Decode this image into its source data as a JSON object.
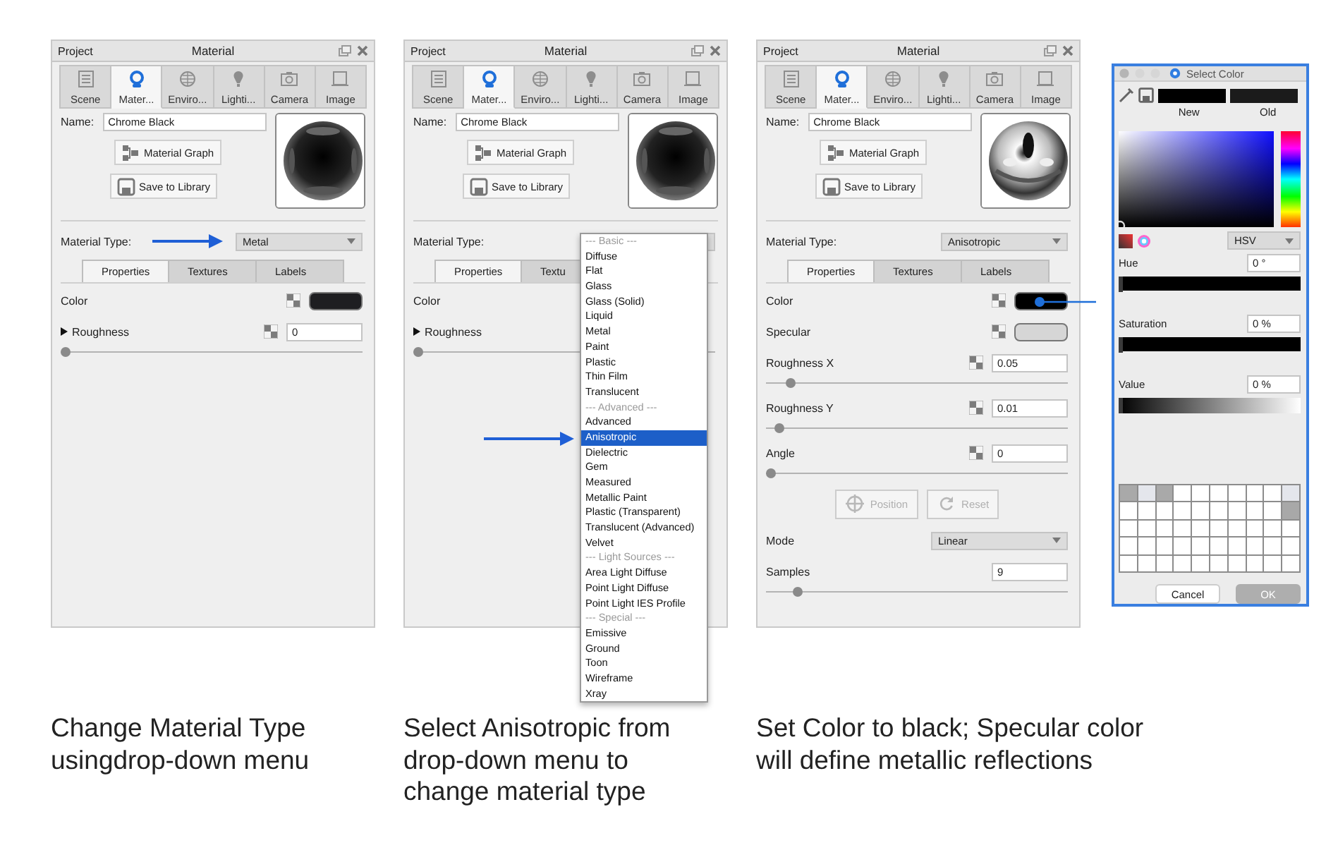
{
  "panels": [
    {
      "header": {
        "left": "Project",
        "title": "Material"
      },
      "tabs": [
        {
          "label": "Scene",
          "kind": "scene",
          "selected": false
        },
        {
          "label": "Mater...",
          "kind": "material",
          "selected": true
        },
        {
          "label": "Enviro...",
          "kind": "environment",
          "selected": false
        },
        {
          "label": "Lighti...",
          "kind": "lighting",
          "selected": false
        },
        {
          "label": "Camera",
          "kind": "camera",
          "selected": false
        },
        {
          "label": "Image",
          "kind": "image",
          "selected": false
        }
      ],
      "name": {
        "label": "Name:",
        "value": "Chrome Black"
      },
      "actions": [
        {
          "label": "Material Graph",
          "kind": "graph"
        },
        {
          "label": "Save to Library",
          "kind": "save"
        }
      ],
      "preview": {
        "kind": "dark"
      },
      "material_type": {
        "label": "Material Type:",
        "value": "Metal"
      },
      "sub_tabs": [
        {
          "label": "Properties",
          "selected": true
        },
        {
          "label": "Textures",
          "selected": false
        },
        {
          "label": "Labels",
          "selected": false
        }
      ],
      "properties": [
        {
          "kind": "color",
          "label": "Color",
          "texture": true,
          "color": "#1e1e21",
          "linked": false
        },
        {
          "kind": "number",
          "label": "Roughness",
          "expanded": false,
          "texture": true,
          "value": "0",
          "level": 0
        }
      ]
    },
    {
      "header": {
        "left": "Project",
        "title": "Material"
      },
      "tabs": [
        {
          "label": "Scene",
          "kind": "scene",
          "selected": false
        },
        {
          "label": "Mater...",
          "kind": "material",
          "selected": true
        },
        {
          "label": "Enviro...",
          "kind": "environment",
          "selected": false
        },
        {
          "label": "Lighti...",
          "kind": "lighting",
          "selected": false
        },
        {
          "label": "Camera",
          "kind": "camera",
          "selected": false
        },
        {
          "label": "Image",
          "kind": "image",
          "selected": false
        }
      ],
      "name": {
        "label": "Name:",
        "value": "Chrome Black"
      },
      "actions": [
        {
          "label": "Material Graph",
          "kind": "graph"
        },
        {
          "label": "Save to Library",
          "kind": "save"
        }
      ],
      "preview": {
        "kind": "dark"
      },
      "material_type": {
        "label": "Material Type:"
      },
      "sub_tabs": [
        {
          "label": "Properties",
          "selected": true
        },
        {
          "label": "Textu",
          "selected": false
        }
      ],
      "properties": [
        {
          "kind": "color",
          "label": "Color",
          "texture": false
        },
        {
          "kind": "number",
          "label": "Roughness",
          "expanded": false,
          "texture": false,
          "level": 0
        }
      ],
      "dropdown": [
        {
          "label": "--- Basic ---",
          "kind": "header",
          "selected": false
        },
        {
          "label": "Diffuse",
          "kind": "option",
          "selected": false
        },
        {
          "label": "Flat",
          "kind": "option",
          "selected": false
        },
        {
          "label": "Glass",
          "kind": "option",
          "selected": false
        },
        {
          "label": "Glass (Solid)",
          "kind": "option",
          "selected": false
        },
        {
          "label": "Liquid",
          "kind": "option",
          "selected": false
        },
        {
          "label": "Metal",
          "kind": "option",
          "selected": false
        },
        {
          "label": "Paint",
          "kind": "option",
          "selected": false
        },
        {
          "label": "Plastic",
          "kind": "option",
          "selected": false
        },
        {
          "label": "Thin Film",
          "kind": "option",
          "selected": false
        },
        {
          "label": "Translucent",
          "kind": "option",
          "selected": false
        },
        {
          "label": "--- Advanced ---",
          "kind": "header",
          "selected": false
        },
        {
          "label": "Advanced",
          "kind": "option",
          "selected": false
        },
        {
          "label": "Anisotropic",
          "kind": "option",
          "selected": true
        },
        {
          "label": "Dielectric",
          "kind": "option",
          "selected": false
        },
        {
          "label": "Gem",
          "kind": "option",
          "selected": false
        },
        {
          "label": "Measured",
          "kind": "option",
          "selected": false
        },
        {
          "label": "Metallic Paint",
          "kind": "option",
          "selected": false
        },
        {
          "label": "Plastic (Transparent)",
          "kind": "option",
          "selected": false
        },
        {
          "label": "Translucent (Advanced)",
          "kind": "option",
          "selected": false
        },
        {
          "label": "Velvet",
          "kind": "option",
          "selected": false
        },
        {
          "label": "--- Light Sources ---",
          "kind": "header",
          "selected": false
        },
        {
          "label": "Area Light Diffuse",
          "kind": "option",
          "selected": false
        },
        {
          "label": "Point Light Diffuse",
          "kind": "option",
          "selected": false
        },
        {
          "label": "Point Light IES Profile",
          "kind": "option",
          "selected": false
        },
        {
          "label": "--- Special ---",
          "kind": "header",
          "selected": false
        },
        {
          "label": "Emissive",
          "kind": "option",
          "selected": false
        },
        {
          "label": "Ground",
          "kind": "option",
          "selected": false
        },
        {
          "label": "Toon",
          "kind": "option",
          "selected": false
        },
        {
          "label": "Wireframe",
          "kind": "option",
          "selected": false
        },
        {
          "label": "Xray",
          "kind": "option",
          "selected": false
        }
      ]
    },
    {
      "header": {
        "left": "Project",
        "title": "Material"
      },
      "tabs": [
        {
          "label": "Scene",
          "kind": "scene",
          "selected": false
        },
        {
          "label": "Mater...",
          "kind": "material",
          "selected": true
        },
        {
          "label": "Enviro...",
          "kind": "environment",
          "selected": false
        },
        {
          "label": "Lighti...",
          "kind": "lighting",
          "selected": false
        },
        {
          "label": "Camera",
          "kind": "camera",
          "selected": false
        },
        {
          "label": "Image",
          "kind": "image",
          "selected": false
        }
      ],
      "name": {
        "label": "Name:",
        "value": "Chrome Black"
      },
      "actions": [
        {
          "label": "Material Graph",
          "kind": "graph"
        },
        {
          "label": "Save to Library",
          "kind": "save"
        }
      ],
      "preview": {
        "kind": "chrome"
      },
      "material_type": {
        "label": "Material Type:",
        "value": "Anisotropic"
      },
      "sub_tabs": [
        {
          "label": "Properties",
          "selected": true
        },
        {
          "label": "Textures",
          "selected": false
        },
        {
          "label": "Labels",
          "selected": false
        }
      ],
      "properties": [
        {
          "kind": "color",
          "label": "Color",
          "texture": true,
          "color": "#000000",
          "linked": true
        },
        {
          "kind": "color",
          "label": "Specular",
          "texture": true,
          "color": "#d6d6d6",
          "linked": false
        },
        {
          "kind": "number",
          "label": "Roughness X",
          "texture": true,
          "value": "0.05",
          "level": 0.07
        },
        {
          "kind": "number",
          "label": "Roughness Y",
          "texture": true,
          "value": "0.01",
          "level": 0.03
        },
        {
          "kind": "number",
          "label": "Angle",
          "texture": true,
          "value": "0",
          "level": 0
        },
        {
          "kind": "buttons",
          "buttons": [
            {
              "label": "Position",
              "kind": "target",
              "disabled": true
            },
            {
              "label": "Reset",
              "kind": "reset",
              "disabled": true
            }
          ]
        },
        {
          "kind": "select",
          "label": "Mode",
          "value": "Linear"
        },
        {
          "kind": "number",
          "label": "Samples",
          "texture": false,
          "value": "9",
          "level": 0.09
        }
      ]
    }
  ],
  "color_picker": {
    "title": "Select Color",
    "swatches": [
      {
        "label": "New",
        "color": "#000000"
      },
      {
        "label": "Old",
        "color": "#1b1b1b"
      }
    ],
    "model": "HSV",
    "channels": [
      {
        "label": "Hue",
        "value": "0 °",
        "kind": "hue",
        "level": 0
      },
      {
        "label": "Saturation",
        "value": "0 %",
        "kind": "saturation",
        "level": 0
      },
      {
        "label": "Value",
        "value": "0 %",
        "kind": "value",
        "level": 0
      }
    ],
    "custom_colors": [
      {
        "color": "#a9a9a9"
      },
      {
        "color": "#e4e6ec"
      },
      {
        "color": "#a9a9a9"
      },
      {
        "color": "#ffffff"
      },
      {
        "color": "#ffffff"
      },
      {
        "color": "#ffffff"
      },
      {
        "color": "#ffffff"
      },
      {
        "color": "#ffffff"
      },
      {
        "color": "#ffffff"
      },
      {
        "color": "#e4e6ec"
      },
      {
        "color": "#ffffff"
      },
      {
        "color": "#ffffff"
      },
      {
        "color": "#ffffff"
      },
      {
        "color": "#ffffff"
      },
      {
        "color": "#ffffff"
      },
      {
        "color": "#ffffff"
      },
      {
        "color": "#ffffff"
      },
      {
        "color": "#ffffff"
      },
      {
        "color": "#ffffff"
      },
      {
        "color": "#a8a8a8"
      },
      {
        "color": "#ffffff"
      },
      {
        "color": "#ffffff"
      },
      {
        "color": "#ffffff"
      },
      {
        "color": "#ffffff"
      },
      {
        "color": "#ffffff"
      },
      {
        "color": "#ffffff"
      },
      {
        "color": "#ffffff"
      },
      {
        "color": "#ffffff"
      },
      {
        "color": "#ffffff"
      },
      {
        "color": "#ffffff"
      },
      {
        "color": "#ffffff"
      },
      {
        "color": "#ffffff"
      },
      {
        "color": "#ffffff"
      },
      {
        "color": "#ffffff"
      },
      {
        "color": "#ffffff"
      },
      {
        "color": "#ffffff"
      },
      {
        "color": "#ffffff"
      },
      {
        "color": "#ffffff"
      },
      {
        "color": "#ffffff"
      },
      {
        "color": "#ffffff"
      },
      {
        "color": "#ffffff"
      },
      {
        "color": "#ffffff"
      },
      {
        "color": "#ffffff"
      },
      {
        "color": "#ffffff"
      },
      {
        "color": "#ffffff"
      },
      {
        "color": "#ffffff"
      },
      {
        "color": "#ffffff"
      },
      {
        "color": "#ffffff"
      },
      {
        "color": "#ffffff"
      },
      {
        "color": "#ffffff"
      }
    ],
    "buttons": [
      {
        "label": "Cancel",
        "default": false
      },
      {
        "label": "OK",
        "default": true
      }
    ]
  },
  "captions": [
    "Change Material Type usingdrop-down menu",
    "Select Anisotropic from drop-down menu to change material type",
    "Set Color to black; Specular color will define metallic reflections"
  ]
}
